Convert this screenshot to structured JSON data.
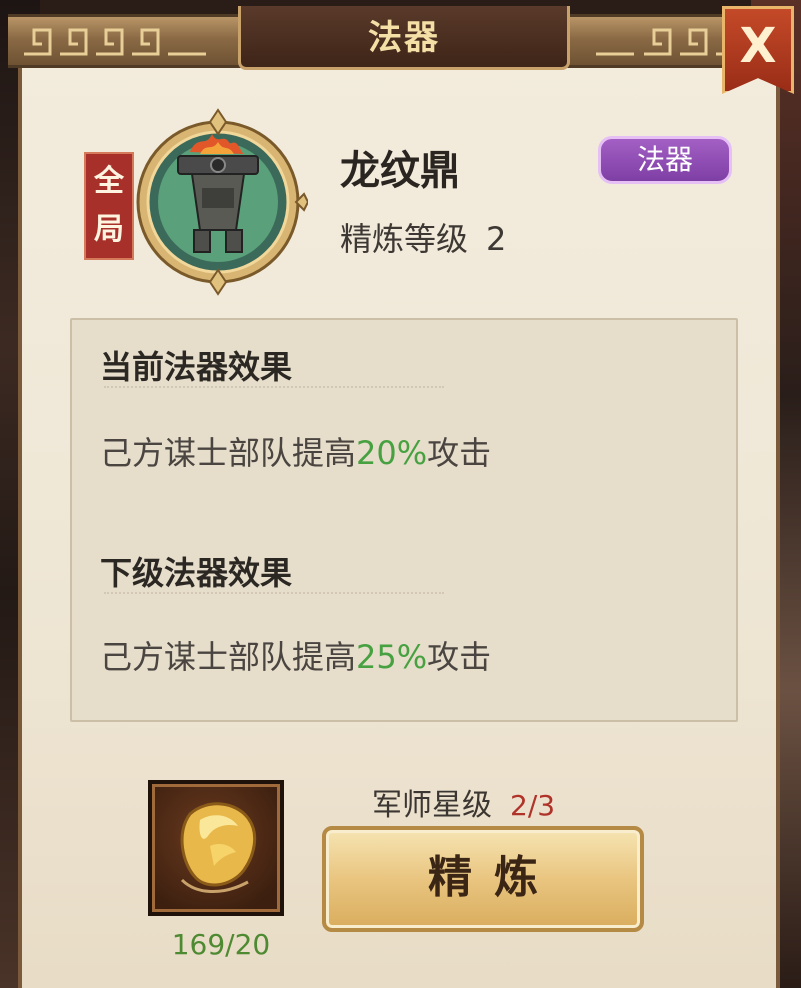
{
  "dialog": {
    "title": "法器",
    "close_label": "X"
  },
  "item": {
    "scope_badge": "全局",
    "name": "龙纹鼎",
    "type_tag": "法器",
    "refine_label": "精炼等级",
    "refine_level": "2",
    "icon": "brazier-icon"
  },
  "current_effect": {
    "title": "当前法器效果",
    "text_prefix": "己方谋士部队提高",
    "percent": "20%",
    "text_suffix": "攻击"
  },
  "next_effect": {
    "title": "下级法器效果",
    "text_prefix": "己方谋士部队提高",
    "percent": "25%",
    "text_suffix": "攻击"
  },
  "strategist": {
    "label": "军师星级",
    "value": "2/3"
  },
  "material": {
    "icon": "gold-ore-icon",
    "count": "169/20"
  },
  "actions": {
    "refine_button": "精炼"
  },
  "colors": {
    "highlight_green": "#47a140",
    "star_red": "#b0332a",
    "tag_purple": "#8e4bb5"
  }
}
